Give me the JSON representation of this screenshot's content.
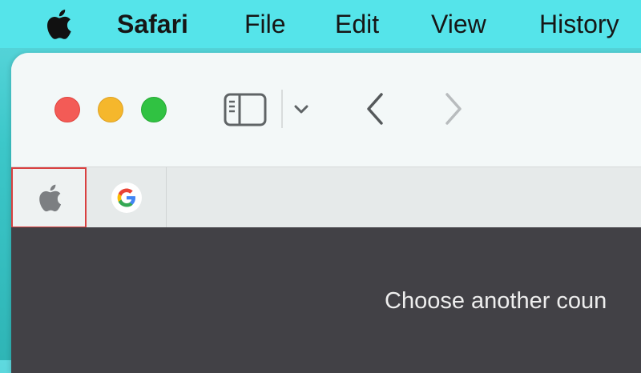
{
  "menubar": {
    "apple_icon": "apple-logo-icon",
    "app_name": "Safari",
    "items": [
      "File",
      "Edit",
      "View",
      "History"
    ]
  },
  "window": {
    "traffic_lights": {
      "close_color": "#f35b56",
      "minimize_color": "#f5b72c",
      "zoom_color": "#30c242"
    },
    "toolbar": {
      "sidebar_icon": "sidebar-icon",
      "tab_group_chevron_icon": "chevron-down-icon",
      "back_icon": "chevron-left-icon",
      "forward_icon": "chevron-right-icon"
    },
    "tabs": [
      {
        "favicon": "apple-logo-icon",
        "selected": true
      },
      {
        "favicon": "google-logo-icon",
        "selected": false
      }
    ],
    "content": {
      "message": "Choose another coun"
    }
  },
  "colors": {
    "menubar_bg": "#55e4ea",
    "content_bg": "#424146",
    "selected_tab_outline": "#d94040"
  }
}
